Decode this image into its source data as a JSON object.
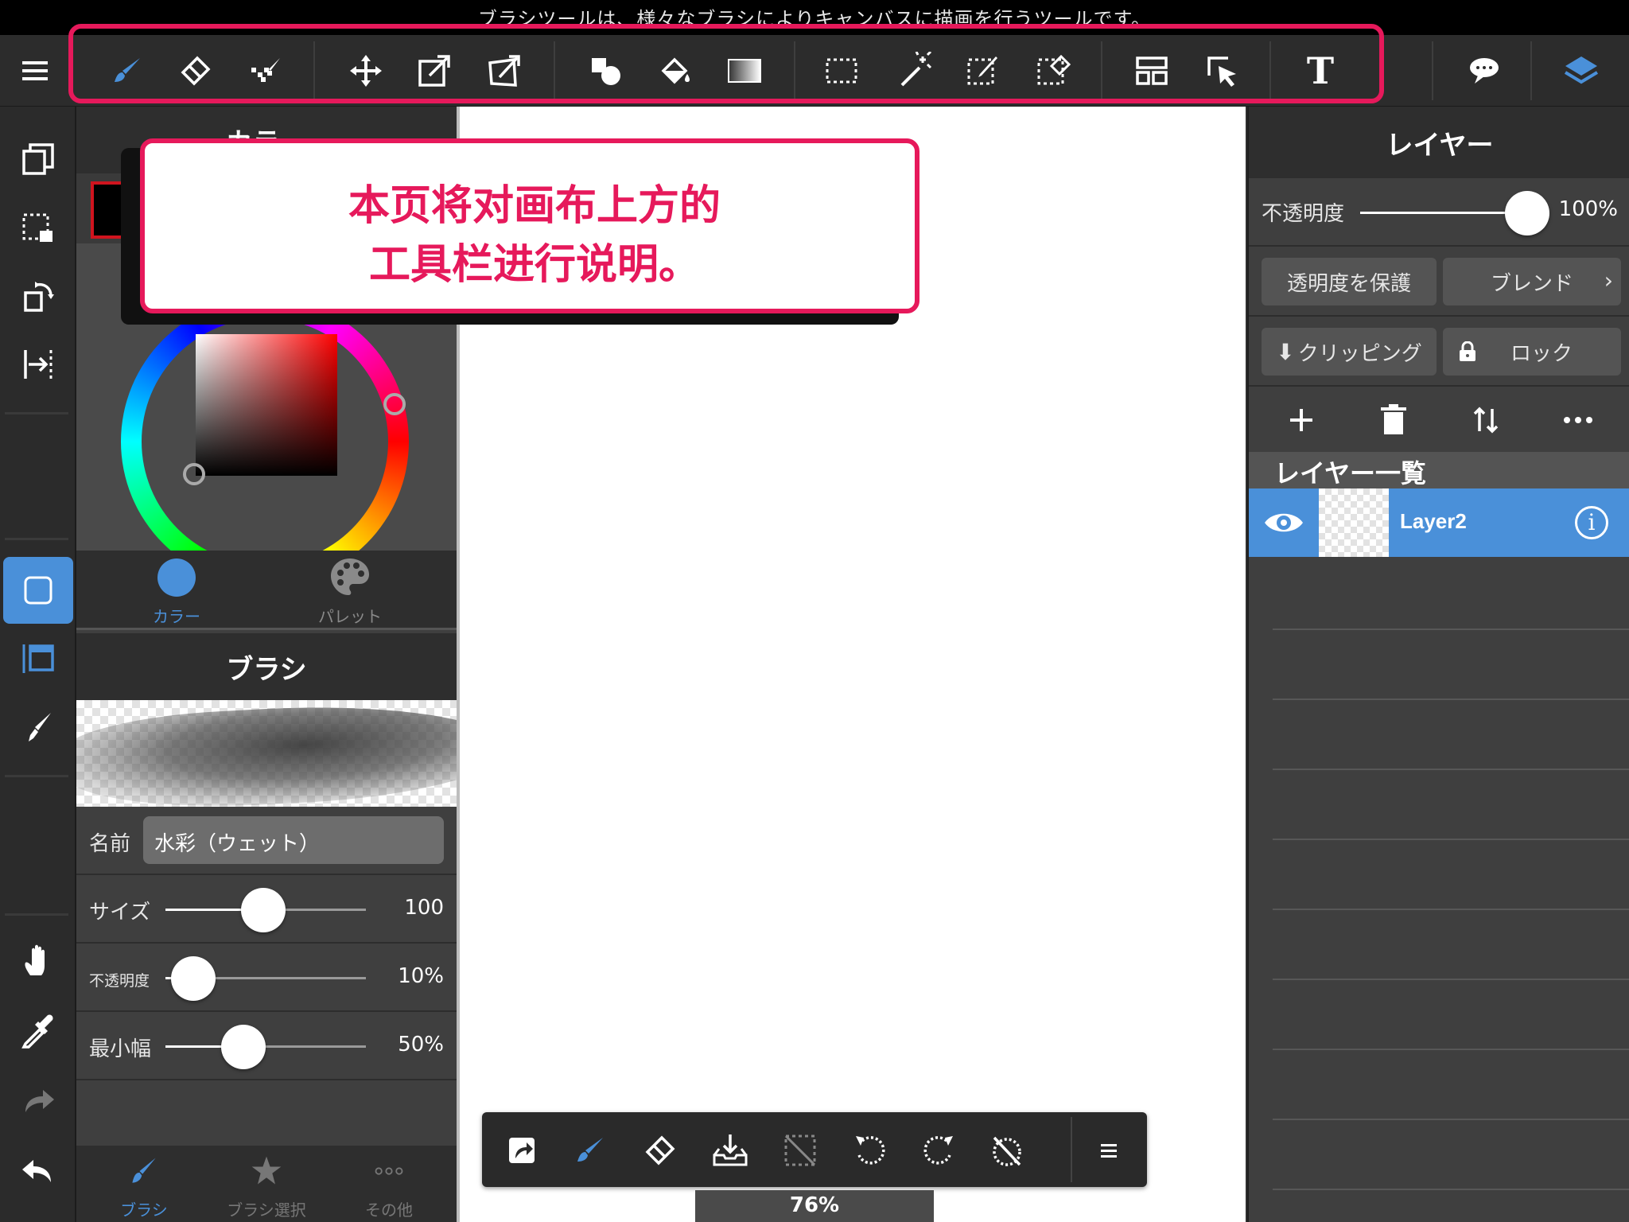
{
  "status_bar": {
    "text": "ブラシツールは、様々なブラシによりキャンバスに描画を行うツールです。"
  },
  "toolbar": {
    "tools": [
      "brush-icon",
      "eraser-icon",
      "dot-brush-icon",
      "move-icon",
      "transform-icon",
      "mesh-transform-icon",
      "shape-icon",
      "fill-icon",
      "gradient-icon",
      "select-rect-icon",
      "magic-wand-icon",
      "select-pen-icon",
      "select-eraser-icon",
      "frame-divider-icon",
      "select-layer-icon",
      "text-icon",
      "speech-bubble-icon",
      "layers-icon"
    ],
    "text_tool_label": "T",
    "highlight_color": "#e6195b"
  },
  "callout": {
    "line1": "本页将对画布上方的",
    "line2": "工具栏进行说明。"
  },
  "left_panel": {
    "color_header": "カラー",
    "color_tabs": [
      {
        "label": "カラー",
        "active": true
      },
      {
        "label": "パレット",
        "active": false
      }
    ],
    "brush_header": "ブラシ",
    "name_label": "名前",
    "name_value": "水彩（ウェット）",
    "size": {
      "label": "サイズ",
      "value": "100",
      "level": 0.49
    },
    "opacity": {
      "label": "不透明度",
      "value": "10%",
      "level": 0.14
    },
    "min_width": {
      "label": "最小幅",
      "value": "50%",
      "level": 0.39
    },
    "brush_tabs": [
      {
        "label": "ブラシ",
        "active": true
      },
      {
        "label": "ブラシ選択",
        "active": false
      },
      {
        "label": "その他",
        "active": false
      }
    ],
    "current_color": "#000000"
  },
  "canvas": {
    "zoom": "76%"
  },
  "right_panel": {
    "header": "レイヤー",
    "opacity_label": "不透明度",
    "opacity_value": "100%",
    "protect_alpha": "透明度を保護",
    "blend": "ブレンド",
    "clipping": "クリッピング",
    "lock": "ロック",
    "list_header": "レイヤー一覧",
    "layers": [
      {
        "name": "Layer2",
        "visible": true,
        "selected": true
      }
    ]
  },
  "colors": {
    "accent": "#4a90d9",
    "annotation": "#e6195b",
    "panel_bg": "#3f3f3f"
  }
}
